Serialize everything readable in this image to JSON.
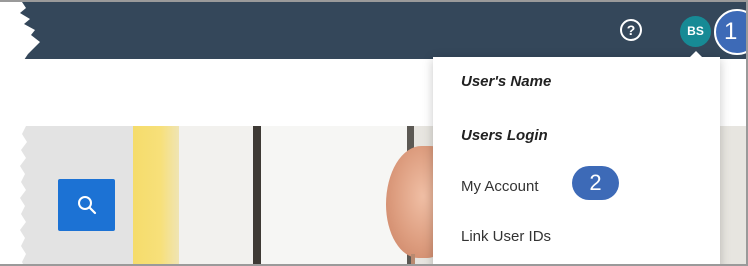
{
  "header": {
    "help_icon": "?",
    "avatar_initials": "BS",
    "callout_1": "1"
  },
  "search": {
    "icon": "search-icon"
  },
  "user_menu": {
    "user_name": "User's Name",
    "user_login": "Users Login",
    "items": [
      {
        "label": "My Account"
      },
      {
        "label": "Link User IDs"
      }
    ],
    "callout_2": "2"
  },
  "colors": {
    "topbar": "#34475a",
    "avatar": "#178a95",
    "callout": "#3d6ab7",
    "search_button": "#1c72d4"
  }
}
